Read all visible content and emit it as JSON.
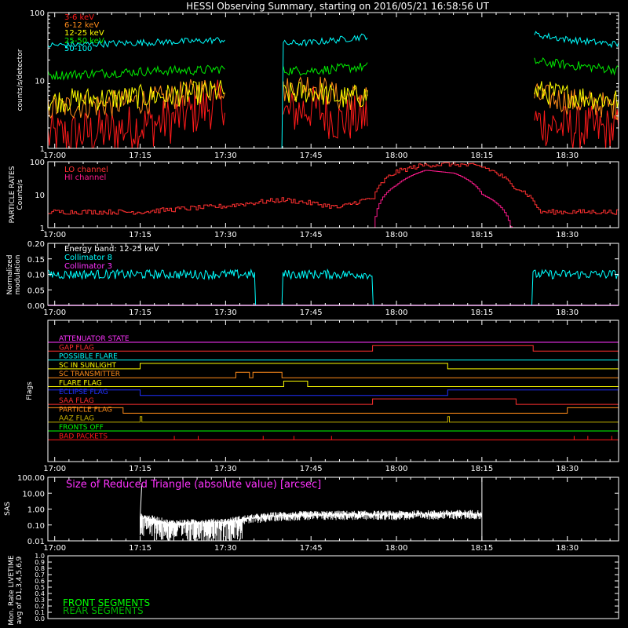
{
  "title": "HESSI Observing Summary, starting on 2016/05/21 16:58:56 UT",
  "colors": {
    "background": "#000000",
    "axes": "#ffffff",
    "e3_6": "#ff1a1a",
    "e6_12": "#ff8c1a",
    "e12_25": "#ffff00",
    "e25_50": "#00ee00",
    "e50_100": "#00ffff",
    "lo": "#ff3030",
    "hi": "#ff1a8c",
    "coll8": "#00ffff",
    "coll3": "#ff33ff",
    "sas": "#ffffff",
    "sas_label": "#ff33ff",
    "front": "#00ff00",
    "rear": "#00b400"
  },
  "time_ticks": [
    "17:00",
    "17:15",
    "17:30",
    "17:45",
    "18:00",
    "18:15",
    "18:30"
  ],
  "panels": {
    "counts": {
      "ylabel": "counts/s/detector",
      "yticks": [
        "100",
        "10",
        "1"
      ],
      "legend": [
        "3-6 keV",
        "6-12 keV",
        "12-25 keV",
        "25-50 keV",
        "50-100"
      ]
    },
    "particle": {
      "ylabel": [
        "PARTICLE RATES",
        "Counts/s"
      ],
      "yticks": [
        "100",
        "10",
        "1"
      ],
      "legend": [
        "LO channel",
        "HI channel"
      ]
    },
    "modulation": {
      "ylabel": [
        "Normalized",
        "modulation"
      ],
      "yticks": [
        "0.20",
        "0.15",
        "0.10",
        "0.05",
        "0.00"
      ],
      "band": "Energy band: 12-25 keV",
      "legend": [
        "Collimator 8",
        "Collimator 3"
      ]
    },
    "flags": {
      "ylabel": "Flags",
      "labels": [
        {
          "name": "ATTENUATOR STATE",
          "color": "#ff33ff"
        },
        {
          "name": "GAP FLAG",
          "color": "#ff3030"
        },
        {
          "name": "POSSIBLE FLARE",
          "color": "#00ffff"
        },
        {
          "name": "SC IN SUNLIGHT",
          "color": "#ffff00"
        },
        {
          "name": "SC TRANSMITTER",
          "color": "#ff8c1a"
        },
        {
          "name": "FLARE FLAG",
          "color": "#ffff00"
        },
        {
          "name": "ECLIPSE FLAG",
          "color": "#2030ff"
        },
        {
          "name": "SAA FLAG",
          "color": "#ff3030"
        },
        {
          "name": "PARTICLE FLAG",
          "color": "#ff8c1a"
        },
        {
          "name": "AAZ FLAG",
          "color": "#c8b400"
        },
        {
          "name": "FRONTS OFF",
          "color": "#00ff00"
        },
        {
          "name": "BAD PACKETS",
          "color": "#ff1a1a"
        }
      ]
    },
    "sas": {
      "ylabel": "SAS",
      "yticks": [
        "100.00",
        "10.00",
        "1.00",
        "0.10",
        "0.01"
      ],
      "label": "Size of Reduced Triangle (absolute value) [arcsec]"
    },
    "livetime": {
      "ylabel": [
        "Mon. Rate LIVETIME",
        "avg of D1,3,4,5,6,9"
      ],
      "yticks": [
        "1.0",
        "0.9",
        "0.8",
        "0.7",
        "0.6",
        "0.5",
        "0.4",
        "0.3",
        "0.2",
        "0.1",
        "0.0"
      ],
      "legend": [
        "FRONT SEGMENTS",
        "REAR SEGMENTS"
      ]
    }
  },
  "chart_data": [
    {
      "type": "line",
      "title": "HESSI Observing Summary, starting on 2016/05/21 16:58:56 UT",
      "ylabel": "counts/s/detector",
      "yscale": "log",
      "ylim": [
        1,
        100
      ],
      "xlim": [
        "17:00",
        "18:40"
      ],
      "x": [
        "17:00",
        "17:10",
        "17:20",
        "17:25",
        "17:30",
        "17:34",
        "17:36",
        "17:40",
        "17:45",
        "17:50",
        "17:55",
        "17:56",
        "18:24",
        "18:30",
        "18:40"
      ],
      "series": [
        {
          "name": "3-6 keV",
          "values": [
            1.5,
            1.8,
            2.5,
            3.5,
            5,
            null,
            null,
            3,
            4,
            2.5,
            3,
            null,
            2.5,
            2,
            1.8
          ]
        },
        {
          "name": "6-12 keV",
          "values": [
            4,
            4.5,
            5.5,
            7,
            8,
            null,
            null,
            7,
            9,
            5.5,
            6,
            null,
            6,
            5,
            4
          ]
        },
        {
          "name": "12-25 keV",
          "values": [
            5,
            5.5,
            6,
            6.5,
            7,
            null,
            null,
            6,
            7,
            5.5,
            6,
            null,
            7,
            6,
            5
          ]
        },
        {
          "name": "25-50 keV",
          "values": [
            12,
            13,
            14,
            14,
            15,
            null,
            null,
            14,
            14,
            15,
            16,
            null,
            19,
            17,
            14
          ]
        },
        {
          "name": "50-100",
          "values": [
            33,
            35,
            37,
            38,
            40,
            null,
            null,
            35,
            36,
            40,
            45,
            null,
            48,
            40,
            33
          ]
        }
      ]
    },
    {
      "type": "line",
      "ylabel": "PARTICLE RATES Counts/s",
      "yscale": "log",
      "ylim": [
        1,
        100
      ],
      "x": [
        "17:00",
        "17:15",
        "17:30",
        "17:40",
        "17:50",
        "17:56",
        "18:00",
        "18:05",
        "18:10",
        "18:15",
        "18:20",
        "18:25",
        "18:30",
        "18:40"
      ],
      "series": [
        {
          "name": "LO channel",
          "values": [
            3,
            3,
            4.5,
            7,
            4,
            8,
            50,
            80,
            85,
            70,
            20,
            3,
            3,
            3
          ]
        },
        {
          "name": "HI channel",
          "values": [
            1,
            1,
            1,
            1,
            1,
            1,
            20,
            55,
            45,
            10,
            1,
            1,
            1,
            1
          ]
        }
      ]
    },
    {
      "type": "line",
      "ylabel": "Normalized modulation",
      "ylim": [
        0,
        0.2
      ],
      "annotation": "Energy band: 12-25 keV",
      "x": [
        "17:00",
        "17:34",
        "17:40",
        "17:56",
        "18:24",
        "18:40"
      ],
      "series": [
        {
          "name": "Collimator 8",
          "values": [
            0.1,
            0.1,
            0.11,
            0.1,
            0.1,
            0.1
          ]
        },
        {
          "name": "Collimator 3",
          "values": [
            0,
            0,
            0,
            0,
            0,
            0
          ]
        }
      ]
    },
    {
      "type": "line",
      "ylabel": "SAS",
      "yscale": "log",
      "ylim": [
        0.01,
        100
      ],
      "annotation": "Size of Reduced Triangle (absolute value) [arcsec]",
      "x": [
        "17:15",
        "17:20",
        "17:30",
        "17:40",
        "17:50",
        "18:00",
        "18:10",
        "18:15"
      ],
      "series": [
        {
          "name": "Size of Reduced Triangle",
          "values": [
            0.3,
            0.12,
            0.15,
            0.4,
            0.45,
            0.45,
            0.5,
            0.5
          ]
        }
      ]
    },
    {
      "type": "line",
      "ylabel": "Mon. Rate LIVETIME avg of D1,3,4,5,6,9",
      "ylim": [
        0,
        1
      ],
      "series": [
        {
          "name": "FRONT SEGMENTS",
          "values": []
        },
        {
          "name": "REAR SEGMENTS",
          "values": []
        }
      ]
    }
  ]
}
